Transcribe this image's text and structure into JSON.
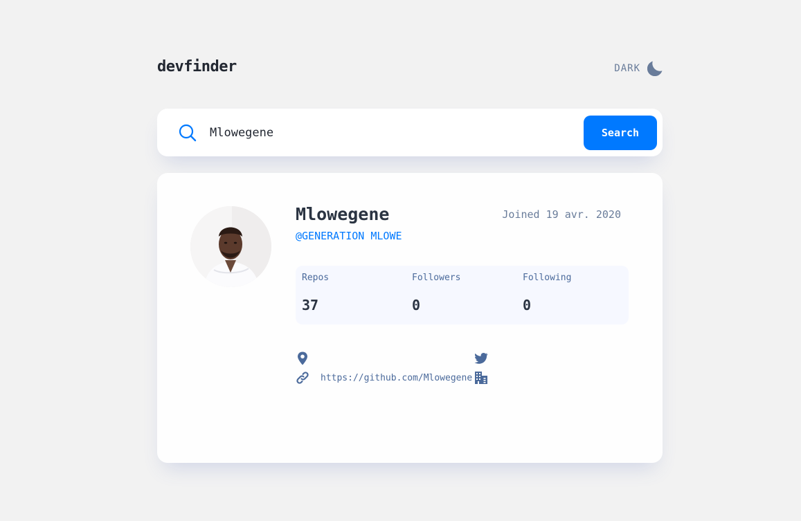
{
  "header": {
    "logo": "devfinder",
    "theme_label": "DARK",
    "theme_icon": "moon-icon"
  },
  "search": {
    "icon": "search-icon",
    "value": "Mlowegene",
    "placeholder": "",
    "button_label": "Search"
  },
  "profile": {
    "avatar_icon": "avatar",
    "name": "Mlowegene",
    "login": "@GENERATION MLOWE",
    "joined": "Joined 19 avr. 2020",
    "stats": {
      "repos_label": "Repos",
      "repos_value": "37",
      "followers_label": "Followers",
      "followers_value": "0",
      "following_label": "Following",
      "following_value": "0"
    },
    "links": {
      "location_icon": "location-pin-icon",
      "location": "",
      "twitter_icon": "twitter-icon",
      "twitter": "",
      "blog_icon": "link-icon",
      "blog": "https://github.com/Mlowegene",
      "company_icon": "building-icon",
      "company": ""
    }
  },
  "colors": {
    "background": "#f2f2f2",
    "card": "#fefefe",
    "accent": "#0079ff",
    "text_dark": "#2b3442",
    "text_muted": "#697c9a",
    "icon": "#4b6a9b",
    "stats_background": "#f6f8ff"
  }
}
